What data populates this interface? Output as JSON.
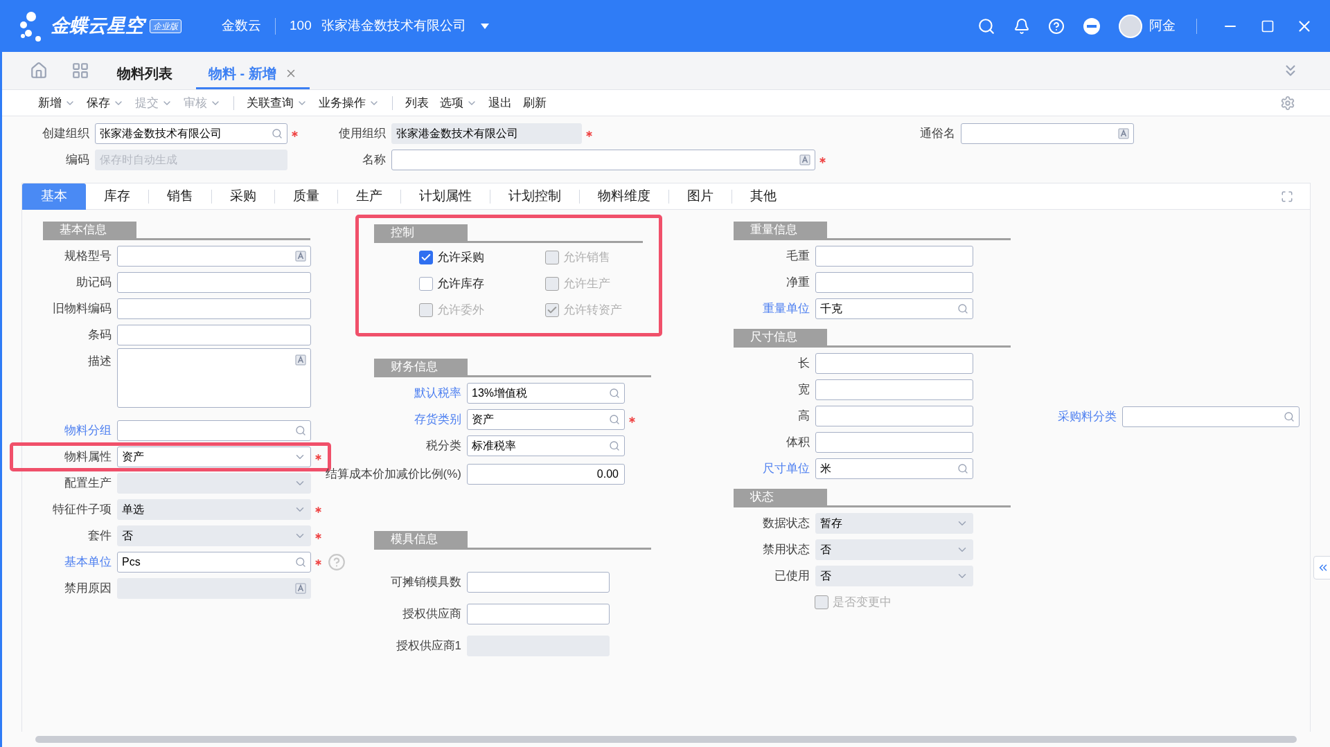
{
  "app_bar": {
    "logo": "金蝶云星空",
    "edition": "企业版",
    "data_center": "金数云",
    "org_code": "100",
    "org_name": "张家港金数技术有限公司",
    "user": "阿金"
  },
  "page_tabs": [
    {
      "label": "物料列表",
      "selected": false,
      "closable": false
    },
    {
      "label": "物料 - 新增",
      "selected": true,
      "closable": true
    }
  ],
  "toolbar_groups": [
    {
      "items": [
        {
          "label": "新增",
          "dropdown": true,
          "disabled": false
        },
        {
          "label": "保存",
          "dropdown": true,
          "disabled": false
        },
        {
          "label": "提交",
          "dropdown": true,
          "disabled": true
        },
        {
          "label": "审核",
          "dropdown": true,
          "disabled": true
        }
      ]
    },
    {
      "items": [
        {
          "label": "关联查询",
          "dropdown": true,
          "disabled": false
        },
        {
          "label": "业务操作",
          "dropdown": true,
          "disabled": false
        }
      ]
    },
    {
      "items": [
        {
          "label": "列表",
          "dropdown": false,
          "disabled": false
        },
        {
          "label": "选项",
          "dropdown": true,
          "disabled": false
        },
        {
          "label": "退出",
          "dropdown": false,
          "disabled": false
        },
        {
          "label": "刷新",
          "dropdown": false,
          "disabled": false
        }
      ]
    }
  ],
  "header_rows": [
    [
      {
        "label": "创建组织",
        "value": "张家港金数技术有限公司",
        "kind": "lookup",
        "required": true,
        "disabled": false,
        "link": false
      },
      {
        "label": "使用组织",
        "value": "张家港金数技术有限公司",
        "kind": "text",
        "required": true,
        "disabled": true,
        "link": false
      },
      {
        "label": "通俗名",
        "kind": "multilang",
        "required": false,
        "disabled": false,
        "link": false
      }
    ],
    [
      {
        "label": "编码",
        "placeholder": "保存时自动生成",
        "kind": "text",
        "required": false,
        "disabled": true,
        "link": false
      },
      {
        "label": "名称",
        "kind": "multilang",
        "required": true,
        "disabled": false,
        "link": false
      }
    ]
  ],
  "form_tabs": [
    {
      "label": "基本",
      "selected": true
    },
    {
      "label": "库存",
      "selected": false
    },
    {
      "label": "销售",
      "selected": false
    },
    {
      "label": "采购",
      "selected": false
    },
    {
      "label": "质量",
      "selected": false
    },
    {
      "label": "生产",
      "selected": false
    },
    {
      "label": "计划属性",
      "selected": false
    },
    {
      "label": "计划控制",
      "selected": false
    },
    {
      "label": "物料维度",
      "selected": false
    },
    {
      "label": "图片",
      "selected": false
    },
    {
      "label": "其他",
      "selected": false
    }
  ],
  "columns": [
    [
      {
        "title": "基本信息",
        "fields": [
          {
            "label": "规格型号",
            "kind": "multilang",
            "required": false,
            "disabled": false,
            "link": false,
            "highlighted": false
          },
          {
            "label": "助记码",
            "kind": "text",
            "required": false,
            "disabled": false,
            "link": false,
            "highlighted": false
          },
          {
            "label": "旧物料编码",
            "kind": "text",
            "required": false,
            "disabled": false,
            "link": false,
            "highlighted": false
          },
          {
            "label": "条码",
            "kind": "text",
            "required": false,
            "disabled": false,
            "link": false,
            "highlighted": false
          },
          {
            "label": "描述",
            "kind": "textarea",
            "required": false,
            "disabled": false,
            "link": false,
            "highlighted": false
          },
          {
            "label": "物料分组",
            "kind": "lookup",
            "required": false,
            "disabled": false,
            "link": true,
            "highlighted": false
          },
          {
            "label": "物料属性",
            "value": "资产",
            "kind": "select",
            "required": true,
            "disabled": false,
            "link": false,
            "highlighted": true
          },
          {
            "label": "配置生产",
            "kind": "select",
            "required": false,
            "disabled": true,
            "link": false,
            "highlighted": false
          },
          {
            "label": "特征件子项",
            "value": "单选",
            "kind": "select",
            "required": true,
            "disabled": true,
            "link": false,
            "highlighted": false
          },
          {
            "label": "套件",
            "value": "否",
            "kind": "select",
            "required": true,
            "disabled": true,
            "link": false,
            "highlighted": false
          },
          {
            "label": "基本单位",
            "value": "Pcs",
            "kind": "lookup",
            "required": true,
            "disabled": false,
            "link": true,
            "highlighted": false,
            "help": true
          },
          {
            "label": "禁用原因",
            "kind": "multilang",
            "required": false,
            "disabled": true,
            "link": false,
            "highlighted": false
          }
        ]
      }
    ],
    [
      {
        "title": "控制",
        "highlighted": true,
        "checkboxes": [
          {
            "label": "允许采购",
            "checked": true,
            "disabled": false
          },
          {
            "label": "允许销售",
            "checked": false,
            "disabled": true
          },
          {
            "label": "允许库存",
            "checked": false,
            "disabled": false
          },
          {
            "label": "允许生产",
            "checked": false,
            "disabled": true
          },
          {
            "label": "允许委外",
            "checked": false,
            "disabled": true
          },
          {
            "label": "允许转资产",
            "checked": true,
            "disabled": true
          }
        ]
      },
      {
        "title": "财务信息",
        "fields": [
          {
            "label": "默认税率",
            "value": "13%增值税",
            "kind": "lookup",
            "required": false,
            "disabled": false,
            "link": true,
            "highlighted": false
          },
          {
            "label": "存货类别",
            "value": "资产",
            "kind": "lookup",
            "required": true,
            "disabled": false,
            "link": true,
            "highlighted": false
          },
          {
            "label": "税分类",
            "value": "标准税率",
            "kind": "lookup",
            "required": false,
            "disabled": false,
            "link": false,
            "highlighted": false
          },
          {
            "label": "结算成本价加减价比例(%)",
            "value": "0.00",
            "kind": "number",
            "required": false,
            "disabled": false,
            "link": false,
            "highlighted": false
          }
        ]
      },
      {
        "title": "模具信息",
        "fields": [
          {
            "label": "可摊销模具数",
            "kind": "text",
            "required": false,
            "disabled": false,
            "link": false,
            "highlighted": false
          },
          {
            "label": "授权供应商",
            "kind": "text",
            "required": false,
            "disabled": false,
            "link": false,
            "highlighted": false
          },
          {
            "label": "授权供应商1",
            "kind": "text",
            "required": false,
            "disabled": true,
            "link": false,
            "highlighted": false
          }
        ]
      }
    ],
    [
      {
        "title": "重量信息",
        "fields": [
          {
            "label": "毛重",
            "kind": "text",
            "required": false,
            "disabled": false,
            "link": false,
            "highlighted": false
          },
          {
            "label": "净重",
            "kind": "text",
            "required": false,
            "disabled": false,
            "link": false,
            "highlighted": false
          },
          {
            "label": "重量单位",
            "value": "千克",
            "kind": "lookup",
            "required": false,
            "disabled": false,
            "link": true,
            "highlighted": false
          }
        ]
      },
      {
        "title": "尺寸信息",
        "fields": [
          {
            "label": "长",
            "kind": "text",
            "required": false,
            "disabled": false,
            "link": false,
            "highlighted": false
          },
          {
            "label": "宽",
            "kind": "text",
            "required": false,
            "disabled": false,
            "link": false,
            "highlighted": false
          },
          {
            "label": "高",
            "kind": "text",
            "required": false,
            "disabled": false,
            "link": false,
            "highlighted": false
          },
          {
            "label": "体积",
            "kind": "text",
            "required": false,
            "disabled": false,
            "link": false,
            "highlighted": false
          },
          {
            "label": "尺寸单位",
            "value": "米",
            "kind": "lookup",
            "required": false,
            "disabled": false,
            "link": true,
            "highlighted": false
          }
        ]
      },
      {
        "title": "状态",
        "fields": [
          {
            "label": "数据状态",
            "value": "暂存",
            "kind": "select",
            "required": false,
            "disabled": true,
            "link": false,
            "highlighted": false
          },
          {
            "label": "禁用状态",
            "value": "否",
            "kind": "select",
            "required": false,
            "disabled": true,
            "link": false,
            "highlighted": false
          },
          {
            "label": "已使用",
            "value": "否",
            "kind": "select",
            "required": false,
            "disabled": true,
            "link": false,
            "highlighted": false
          }
        ],
        "checkboxes": [
          {
            "label": "是否变更中",
            "checked": false,
            "disabled": true
          }
        ]
      }
    ],
    [
      {
        "fields": [
          {
            "label": "采购料分类",
            "kind": "lookup",
            "required": false,
            "disabled": false,
            "link": true,
            "highlighted": false
          }
        ]
      }
    ]
  ]
}
